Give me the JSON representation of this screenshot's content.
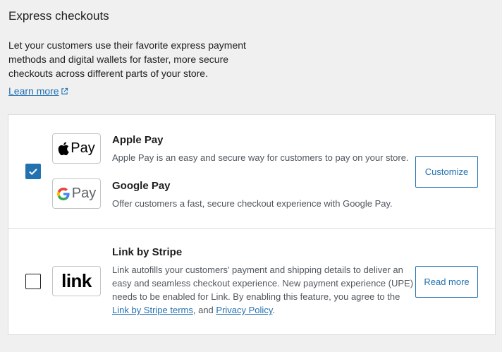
{
  "section": {
    "title": "Express checkouts",
    "description": "Let your customers use their favorite express payment methods and digital wallets for faster, more secure checkouts across different parts of your store.",
    "learn_more": "Learn more"
  },
  "methods": {
    "group1": {
      "checked": true,
      "button_label": "Customize",
      "apple_pay": {
        "logo_text": "Pay",
        "title": "Apple Pay",
        "description": "Apple Pay is an easy and secure way for customers to pay on your store."
      },
      "google_pay": {
        "logo_text": "Pay",
        "title": "Google Pay",
        "description": "Offer customers a fast, secure checkout experience with Google Pay."
      }
    },
    "link": {
      "checked": false,
      "logo_text": "link",
      "title": "Link by Stripe",
      "description_before": "Link autofills your customers’ payment and shipping details to deliver an easy and seamless checkout experience. New payment experience (UPE) needs to be enabled for Link. By enabling this feature, you agree to the ",
      "terms_link": "Link by Stripe terms",
      "description_middle": ", and ",
      "privacy_link": "Privacy Policy",
      "description_end": ".",
      "button_label": "Read more"
    }
  },
  "colors": {
    "accent": "#2271b1",
    "background": "#f0f0f1",
    "border": "#dcdcde"
  }
}
